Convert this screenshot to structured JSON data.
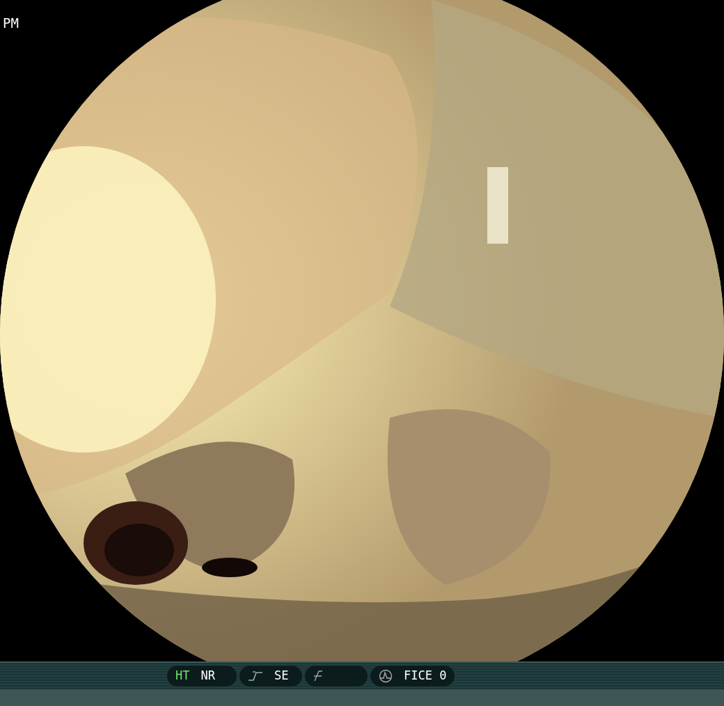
{
  "overlay": {
    "label": "PM"
  },
  "status_bar": {
    "groups": [
      {
        "kind": "toggles",
        "items": [
          {
            "label": "HT",
            "on": true
          },
          {
            "label": "NR",
            "on": false
          }
        ]
      },
      {
        "kind": "enhance",
        "label": "SE"
      },
      {
        "kind": "blank"
      },
      {
        "kind": "fice",
        "label": "FICE 0"
      }
    ]
  }
}
